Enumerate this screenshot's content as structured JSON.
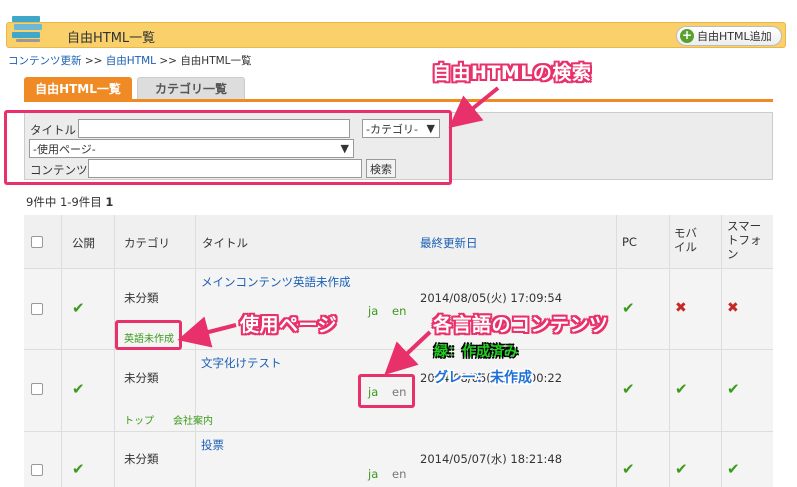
{
  "header": {
    "title": "自由HTML一覧",
    "add_button": "自由HTML追加",
    "add_icon": "plus-circle-icon",
    "icon": "stack-icon"
  },
  "breadcrumb": {
    "item1": "コンテンツ更新",
    "sep": ">>",
    "item2": "自由HTML",
    "item3": "自由HTML一覧"
  },
  "tabs": {
    "active": "自由HTML一覧",
    "inactive": "カテゴリ一覧"
  },
  "search": {
    "title_label": "タイトル",
    "title_value": "",
    "category_select": "-カテゴリ-",
    "page_select": "-使用ページ-",
    "content_label": "コンテンツ",
    "content_value": "",
    "search_button": "検索"
  },
  "count": {
    "text": "9件中 1-9件目",
    "page": "1"
  },
  "table": {
    "headers": {
      "public": "公開",
      "category": "カテゴリ",
      "title": "タイトル",
      "updated": "最終更新日",
      "pc": "PC",
      "mobile": "モバイル",
      "smartphone": "スマートフォン"
    },
    "rows": [
      {
        "category": "未分類",
        "title": "メインコンテンツ英語未作成",
        "ja": "ja",
        "en": "en",
        "updated": "2014/08/05(火) 17:09:54",
        "page_tag": "英語未作成"
      },
      {
        "category": "未分類",
        "title": "文字化けテスト",
        "ja": "ja",
        "en": "en",
        "updated": "2014/08/05(火) 17:00:22",
        "page_tag1": "トップ",
        "page_tag2": "会社案内"
      },
      {
        "category": "未分類",
        "title": "投票",
        "ja": "ja",
        "en": "en",
        "updated": "2014/05/07(水) 18:21:48"
      }
    ]
  },
  "annotations": {
    "search": "自由HTMLの検索",
    "page": "使用ページ",
    "lang": "各言語のコンテンツ",
    "green": "緑：作成済み",
    "gray": "グレー：未作成"
  },
  "colors": {
    "accent": "#f08a24",
    "highlight": "#e8306a",
    "link": "#1a5fb4",
    "ok": "#3a9a1a",
    "ng": "#c62828"
  }
}
